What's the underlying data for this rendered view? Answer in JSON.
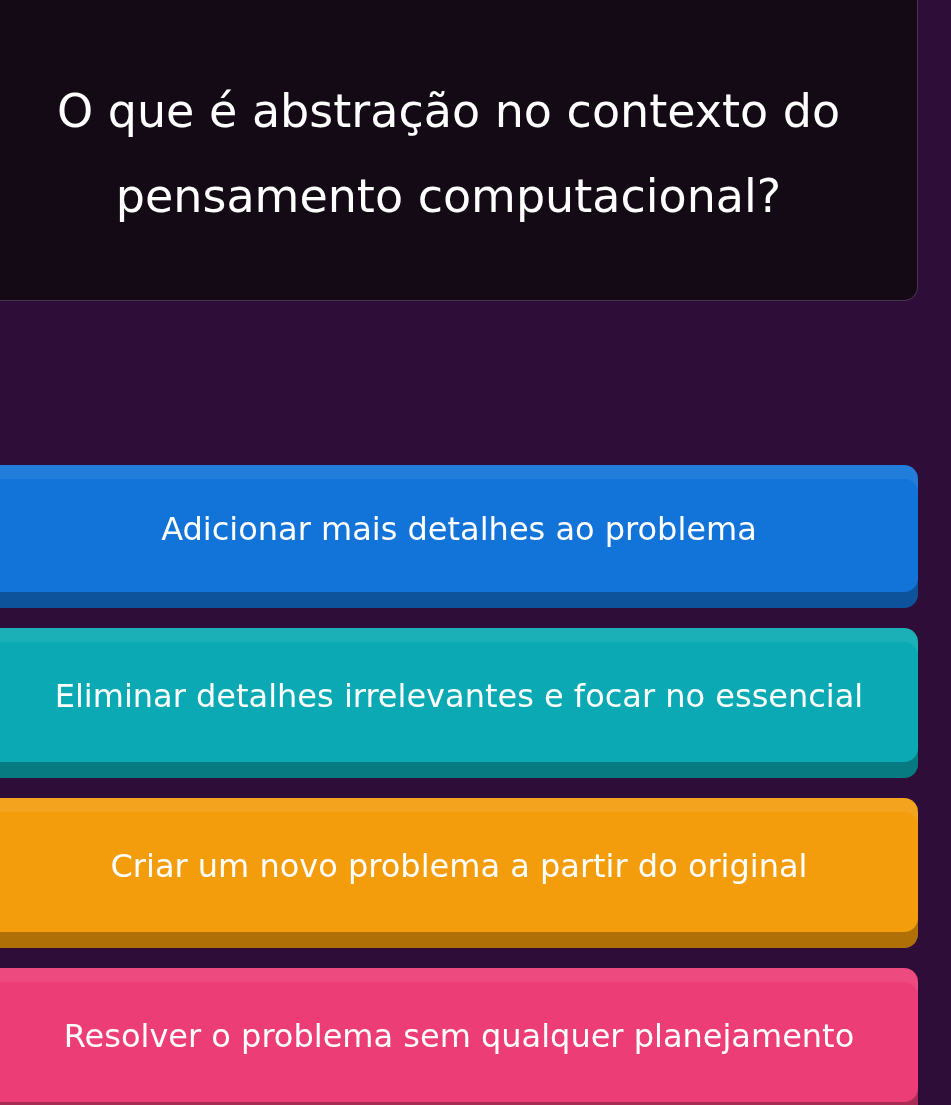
{
  "question": "O que é abstração no contexto do pensamento computacional?",
  "answers": [
    {
      "text": "Adicionar mais detalhes ao problema",
      "color": "#1273d8"
    },
    {
      "text": "Eliminar detalhes irrelevantes e focar no essencial",
      "color": "#0aa9b3"
    },
    {
      "text": "Criar um novo problema a partir do original",
      "color": "#f39c0c"
    },
    {
      "text": "Resolver o problema sem qualquer planejamento",
      "color": "#ec3d76"
    }
  ]
}
